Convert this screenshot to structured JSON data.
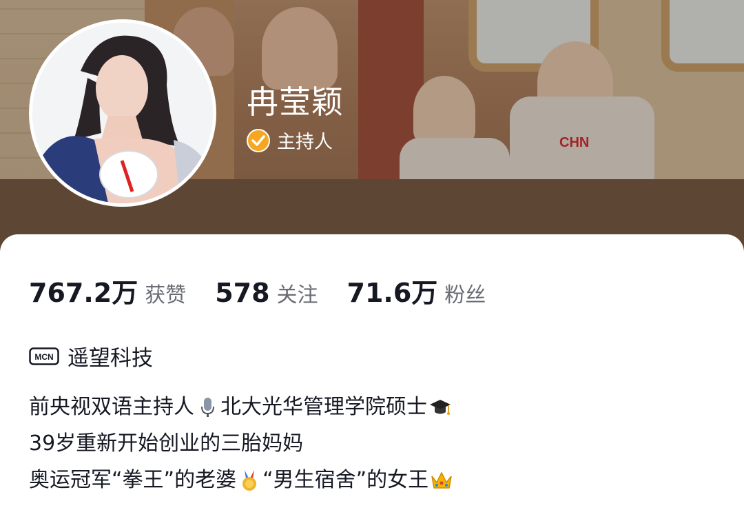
{
  "profile": {
    "name": "冉莹颖",
    "verified_label": "主持人",
    "cover_shirt_text": "CHN"
  },
  "stats": [
    {
      "value": "767.2万",
      "label": "获赞"
    },
    {
      "value": "578",
      "label": "关注"
    },
    {
      "value": "71.6万",
      "label": "粉丝"
    }
  ],
  "mcn": {
    "icon_text": "MCN",
    "name": "遥望科技"
  },
  "bio": {
    "line1a": "前央视双语主持人",
    "line1b": "北大光华管理学院硕士",
    "line2": "39岁重新开始创业的三胎妈妈",
    "line3a": "奥运冠军“拳王”的老婆",
    "line3b": "“男生宿舍”的女王",
    "emoji": [
      "microphone-icon",
      "graduation-cap-icon",
      "medal-icon",
      "crown-icon"
    ]
  },
  "colors": {
    "verify_badge": "#f5a623",
    "text_primary": "#161823",
    "text_secondary": "#6b6d74"
  }
}
